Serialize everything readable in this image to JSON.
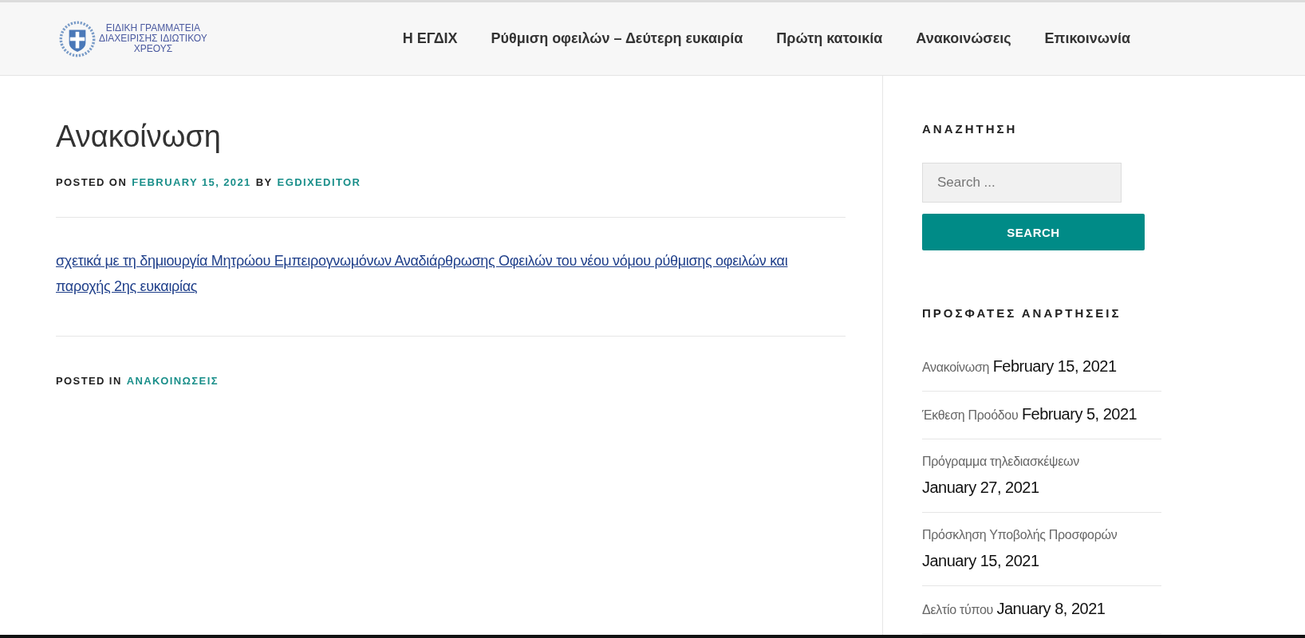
{
  "header": {
    "logo_lines": [
      "ΕΙΔΙΚΗ ΓΡΑΜΜΑΤΕΙΑ",
      "ΔΙΑΧΕΙΡΙΣΗΣ ΙΔΙΩΤΙΚΟΥ",
      "ΧΡΕΟΥΣ"
    ],
    "nav": [
      "Η ΕΓΔΙΧ",
      "Ρύθμιση οφειλών – Δεύτερη ευκαιρία",
      "Πρώτη κατοικία",
      "Ανακοινώσεις",
      "Επικοινωνία"
    ]
  },
  "post": {
    "title": "Ανακοίνωση",
    "posted_on_label": "POSTED ON",
    "date": "FEBRUARY 15, 2021",
    "by_label": "BY",
    "author": "EGDIXEDITOR",
    "link": "σχετικά με τη δημιουργία Μητρώου Εμπειρογνωμόνων Αναδιάρθρωσης Οφειλών του νέου νόμου ρύθμισης οφειλών και παροχής 2ης ευκαιρίας",
    "posted_in_label": "POSTED IN",
    "category": "ΑΝΑΚΟΙΝΩΣΕΙΣ"
  },
  "sidebar": {
    "search_heading": "ΑΝΑΖΗΤΗΣΗ",
    "search_placeholder": "Search ...",
    "search_button": "SEARCH",
    "recent_heading": "ΠΡΟΣΦΑΤΕΣ ΑΝΑΡΤΗΣΕΙΣ",
    "recent": [
      {
        "title": "Ανακοίνωση",
        "date": "February 15, 2021"
      },
      {
        "title": "Έκθεση Προόδου",
        "date": "February 5, 2021"
      },
      {
        "title": "Πρόγραμμα τηλεδιασκέψεων",
        "date": "January 27, 2021"
      },
      {
        "title": "Πρόσκληση Υποβολής Προσφορών",
        "date": "January 15, 2021"
      },
      {
        "title": "Δελτίο τύπου",
        "date": "January 8, 2021"
      }
    ]
  }
}
